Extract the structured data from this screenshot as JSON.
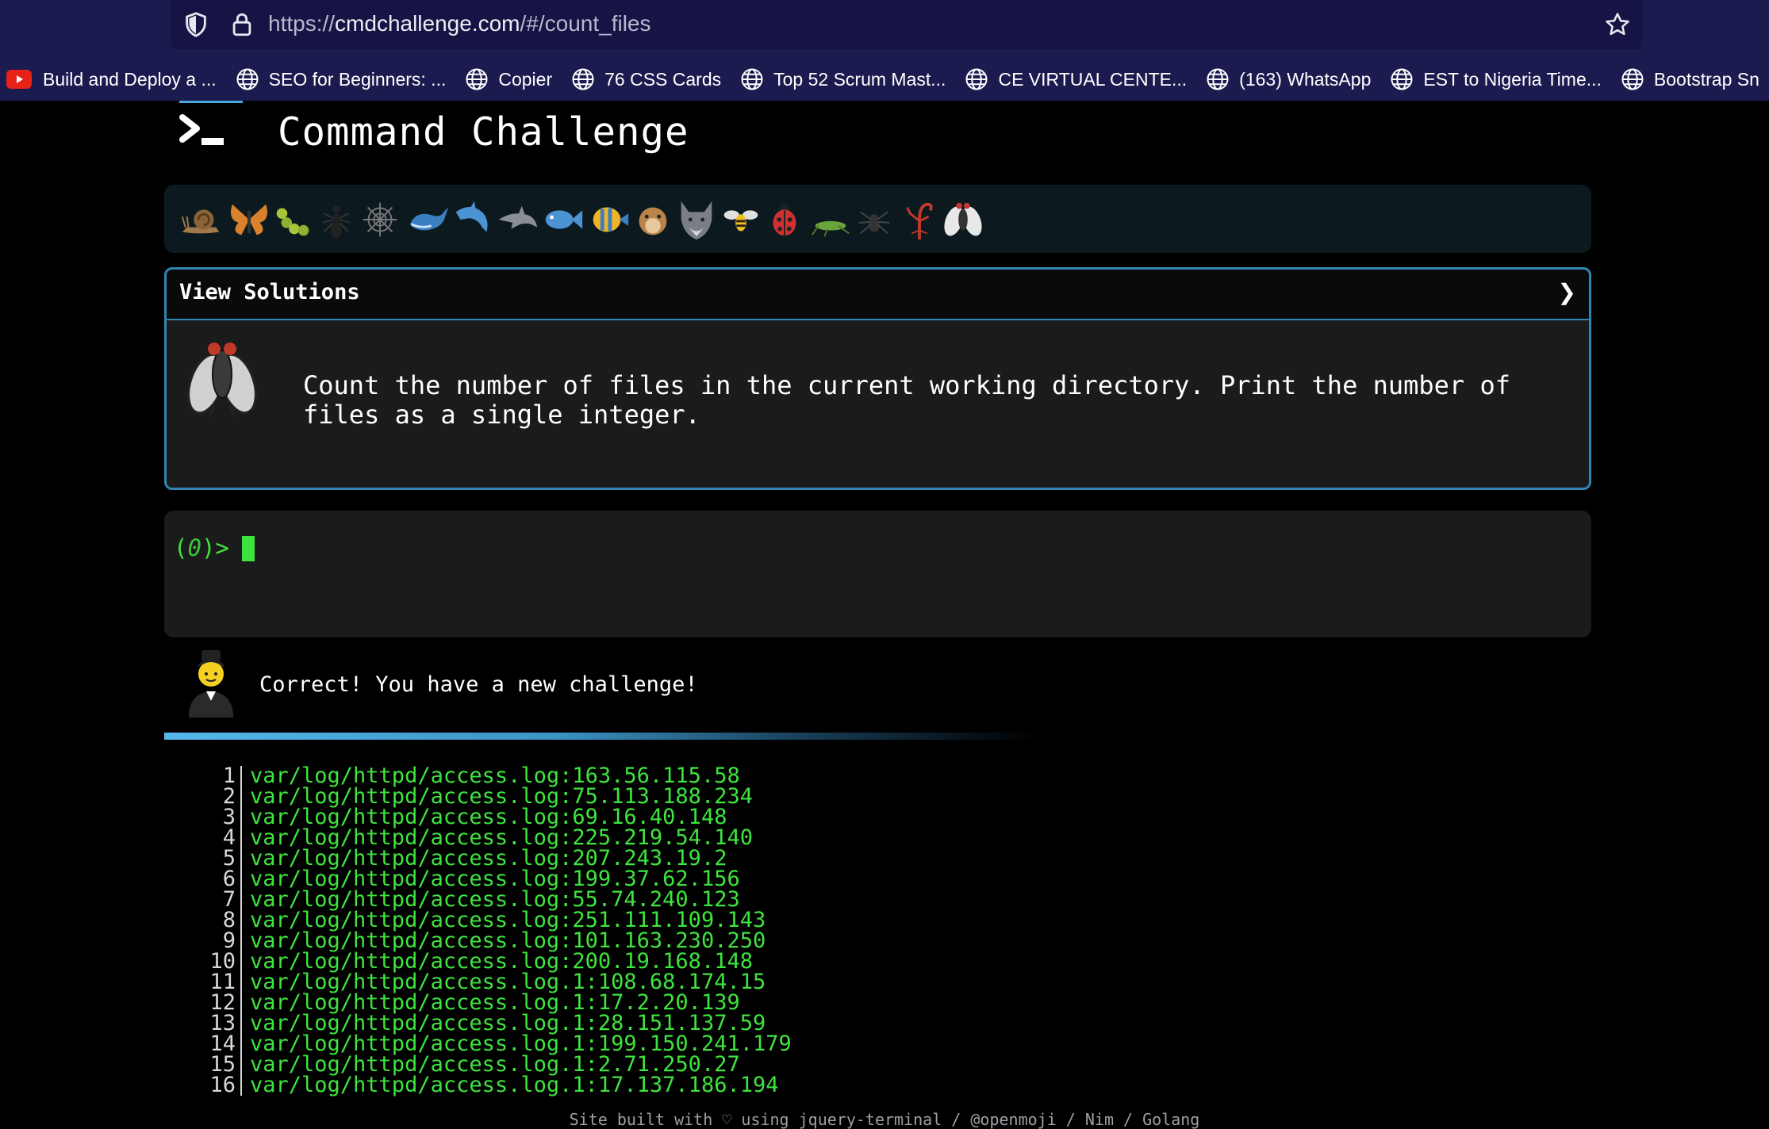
{
  "browser": {
    "url": {
      "scheme": "https://",
      "host": "cmdchallenge.com",
      "path": "/#/count_files"
    },
    "bookmarks": [
      {
        "label": "Build and Deploy a ...",
        "icon": "youtube-icon"
      },
      {
        "label": "SEO for Beginners: ...",
        "icon": "globe-icon"
      },
      {
        "label": "Copier",
        "icon": "globe-icon"
      },
      {
        "label": "76 CSS Cards",
        "icon": "globe-icon"
      },
      {
        "label": "Top 52 Scrum Mast...",
        "icon": "globe-icon"
      },
      {
        "label": "CE VIRTUAL CENTE...",
        "icon": "globe-icon"
      },
      {
        "label": "(163) WhatsApp",
        "icon": "globe-icon"
      },
      {
        "label": "EST to Nigeria Time...",
        "icon": "globe-icon"
      },
      {
        "label": "Bootstrap Sn",
        "icon": "globe-icon"
      }
    ]
  },
  "header": {
    "title": "Command Challenge",
    "logo": "terminal-prompt-icon"
  },
  "animals": [
    "snail",
    "butterfly",
    "caterpillar",
    "ant",
    "spider-web",
    "whale",
    "dolphin-blue",
    "dolphin-grey",
    "fish",
    "tropical-fish",
    "blowfish",
    "wolf",
    "bee",
    "ladybug",
    "cricket",
    "spider",
    "scorpion",
    "fly"
  ],
  "panel": {
    "heading": "View Solutions",
    "chevron": "❯",
    "challenge": "Count the number of files in the current working directory. Print the number of files as a single integer."
  },
  "terminal": {
    "prompt_open": "(",
    "exit_code": "0",
    "prompt_close": ")>"
  },
  "feedback": {
    "message": "Correct! You have a new challenge!",
    "progress": 1.0
  },
  "output": [
    {
      "n": "1",
      "text": "var/log/httpd/access.log:163.56.115.58"
    },
    {
      "n": "2",
      "text": "var/log/httpd/access.log:75.113.188.234"
    },
    {
      "n": "3",
      "text": "var/log/httpd/access.log:69.16.40.148"
    },
    {
      "n": "4",
      "text": "var/log/httpd/access.log:225.219.54.140"
    },
    {
      "n": "5",
      "text": "var/log/httpd/access.log:207.243.19.2"
    },
    {
      "n": "6",
      "text": "var/log/httpd/access.log:199.37.62.156"
    },
    {
      "n": "7",
      "text": "var/log/httpd/access.log:55.74.240.123"
    },
    {
      "n": "8",
      "text": "var/log/httpd/access.log:251.111.109.143"
    },
    {
      "n": "9",
      "text": "var/log/httpd/access.log:101.163.230.250"
    },
    {
      "n": "10",
      "text": "var/log/httpd/access.log:200.19.168.148"
    },
    {
      "n": "11",
      "text": "var/log/httpd/access.log.1:108.68.174.15"
    },
    {
      "n": "12",
      "text": "var/log/httpd/access.log.1:17.2.20.139"
    },
    {
      "n": "13",
      "text": "var/log/httpd/access.log.1:28.151.137.59"
    },
    {
      "n": "14",
      "text": "var/log/httpd/access.log.1:199.150.241.179"
    },
    {
      "n": "15",
      "text": "var/log/httpd/access.log.1:2.71.250.27"
    },
    {
      "n": "16",
      "text": "var/log/httpd/access.log.1:17.137.186.194"
    }
  ],
  "footer": {
    "text": "Site built with ♡ using jquery-terminal / @openmoji / Nim / Golang"
  }
}
